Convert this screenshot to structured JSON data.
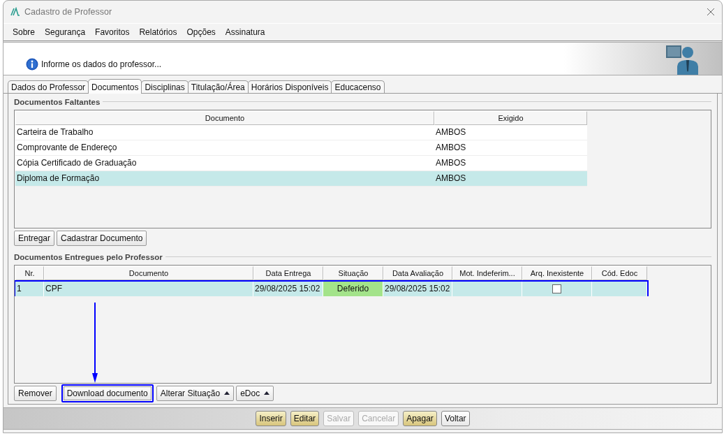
{
  "window": {
    "title": "Cadastro de Professor"
  },
  "menu": [
    "Sobre",
    "Segurança",
    "Favoritos",
    "Relatórios",
    "Opções",
    "Assinatura"
  ],
  "header": {
    "message": "Informe os dados do professor..."
  },
  "tabs": [
    {
      "label": "Dados do Professor",
      "selected": false
    },
    {
      "label": "Documentos",
      "selected": true
    },
    {
      "label": "Disciplinas",
      "selected": false
    },
    {
      "label": "Titulação/Área",
      "selected": false
    },
    {
      "label": "Horários Disponíveis",
      "selected": false
    },
    {
      "label": "Educacenso",
      "selected": false
    }
  ],
  "missing_documents": {
    "title": "Documentos Faltantes",
    "columns": [
      "Documento",
      "Exigido"
    ],
    "rows": [
      {
        "cells": [
          {
            "kind": "text",
            "text": "Carteira de Trabalho"
          },
          {
            "kind": "text",
            "text": "AMBOS"
          }
        ],
        "selected": false,
        "highlighted": false
      },
      {
        "cells": [
          {
            "kind": "text",
            "text": "Comprovante de Endereço"
          },
          {
            "kind": "text",
            "text": "AMBOS"
          }
        ],
        "selected": false,
        "highlighted": false
      },
      {
        "cells": [
          {
            "kind": "text",
            "text": "Cópia Certificado de Graduação"
          },
          {
            "kind": "text",
            "text": "AMBOS"
          }
        ],
        "selected": false,
        "highlighted": false
      },
      {
        "cells": [
          {
            "kind": "text",
            "text": "Diploma de Formação"
          },
          {
            "kind": "text",
            "text": "AMBOS"
          }
        ],
        "selected": true,
        "highlighted": false
      }
    ],
    "buttons": [
      {
        "label": "Entregar",
        "kind": "plain",
        "highlighted": false
      },
      {
        "label": "Cadastrar Documento",
        "kind": "plain",
        "highlighted": false
      }
    ]
  },
  "delivered_documents": {
    "title": "Documentos Entregues pelo Professor",
    "columns": [
      "Nr.",
      "Documento",
      "Data Entrega",
      "Situação",
      "Data Avaliação",
      "Mot. Indeferim...",
      "Arq. Inexistente",
      "Cód. Edoc"
    ],
    "rows": [
      {
        "cells": [
          {
            "kind": "text",
            "text": "1"
          },
          {
            "kind": "text",
            "text": "CPF"
          },
          {
            "kind": "text",
            "text": "29/08/2025 15:02"
          },
          {
            "kind": "status",
            "text": "Deferido",
            "color": "#a3e38a"
          },
          {
            "kind": "text",
            "text": "29/08/2025 15:02"
          },
          {
            "kind": "empty"
          },
          {
            "kind": "checkbox",
            "checked": false
          },
          {
            "kind": "empty"
          }
        ],
        "selected": true,
        "highlighted": true
      }
    ],
    "buttons": [
      {
        "label": "Remover",
        "kind": "plain",
        "highlighted": false
      },
      {
        "label": "Download documento",
        "kind": "plain",
        "highlighted": true
      },
      {
        "label": "Alterar Situação",
        "kind": "dropdown",
        "highlighted": false
      },
      {
        "label": "eDoc",
        "kind": "dropdown",
        "highlighted": false
      }
    ]
  },
  "actions": [
    {
      "label": "Inserir",
      "kind": "primary",
      "disabled": false
    },
    {
      "label": "Editar",
      "kind": "primary",
      "disabled": false
    },
    {
      "label": "Salvar",
      "kind": "primary",
      "disabled": true
    },
    {
      "label": "Cancelar",
      "kind": "primary",
      "disabled": true
    },
    {
      "label": "Apagar",
      "kind": "primary",
      "disabled": false
    },
    {
      "label": "Voltar",
      "kind": "plain",
      "disabled": false
    }
  ]
}
